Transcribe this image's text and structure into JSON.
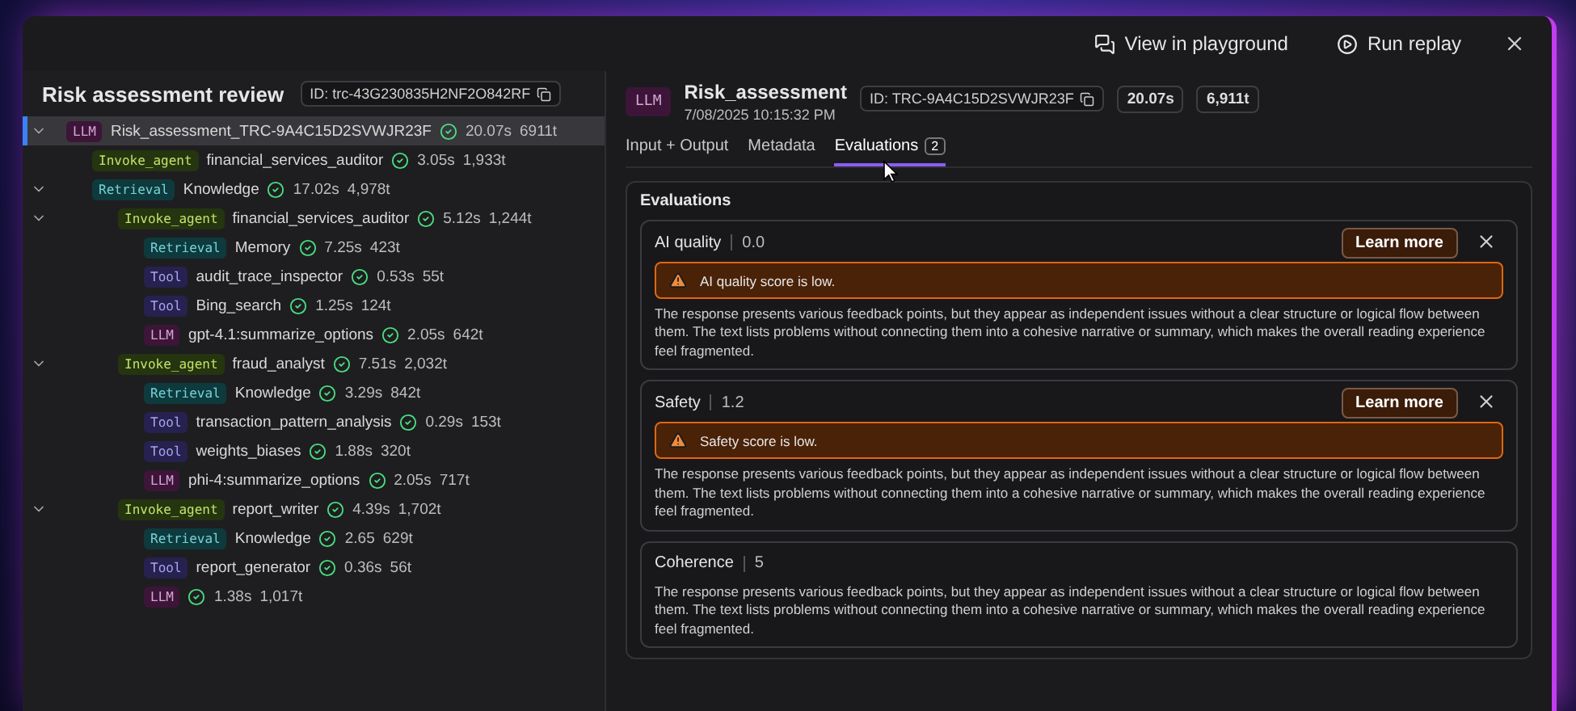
{
  "toolbar": {
    "actions": [
      {
        "kind": "playground",
        "label": "View in playground"
      },
      {
        "kind": "replay",
        "label": "Run replay"
      }
    ]
  },
  "trace": {
    "title": "Risk assessment review",
    "id": "ID: trc-43G230835H2NF2O842RF",
    "tree": [
      {
        "kind": "llm",
        "tag": "LLM",
        "name": "Risk_assessment_TRC-9A4C15D2SVWJR23F",
        "succeeded": true,
        "duration": "20.07s",
        "tokens": "6911t",
        "selected": true,
        "expanded": true,
        "children": [
          {
            "kind": "invoke_agent",
            "tag": "Invoke_agent",
            "name": "financial_services_auditor",
            "succeeded": true,
            "duration": "3.05s",
            "tokens": "1,933t",
            "selected": false
          },
          {
            "kind": "retrieval",
            "tag": "Retrieval",
            "name": "Knowledge",
            "succeeded": true,
            "duration": "17.02s",
            "tokens": "4,978t",
            "selected": false,
            "expanded": true,
            "children": [
              {
                "kind": "invoke_agent",
                "tag": "Invoke_agent",
                "name": "financial_services_auditor",
                "succeeded": true,
                "duration": "5.12s",
                "tokens": "1,244t",
                "selected": false,
                "expanded": true,
                "children": [
                  {
                    "kind": "retrieval",
                    "tag": "Retrieval",
                    "name": "Memory",
                    "succeeded": true,
                    "duration": "7.25s",
                    "tokens": "423t",
                    "selected": false
                  },
                  {
                    "kind": "tool",
                    "tag": "Tool",
                    "name": "audit_trace_inspector",
                    "succeeded": true,
                    "duration": "0.53s",
                    "tokens": "55t",
                    "selected": false
                  },
                  {
                    "kind": "tool",
                    "tag": "Tool",
                    "name": "Bing_search",
                    "succeeded": true,
                    "duration": "1.25s",
                    "tokens": "124t",
                    "selected": false
                  },
                  {
                    "kind": "llm",
                    "tag": "LLM",
                    "name": "gpt-4.1:summarize_options",
                    "succeeded": true,
                    "duration": "2.05s",
                    "tokens": "642t",
                    "selected": false
                  }
                ]
              },
              {
                "kind": "invoke_agent",
                "tag": "Invoke_agent",
                "name": "fraud_analyst",
                "succeeded": true,
                "duration": "7.51s",
                "tokens": "2,032t",
                "selected": false,
                "expanded": true,
                "children": [
                  {
                    "kind": "retrieval",
                    "tag": "Retrieval",
                    "name": "Knowledge",
                    "succeeded": true,
                    "duration": "3.29s",
                    "tokens": "842t",
                    "selected": false
                  },
                  {
                    "kind": "tool",
                    "tag": "Tool",
                    "name": "transaction_pattern_analysis",
                    "succeeded": true,
                    "duration": "0.29s",
                    "tokens": "153t",
                    "selected": false
                  },
                  {
                    "kind": "tool",
                    "tag": "Tool",
                    "name": "weights_biases",
                    "succeeded": true,
                    "duration": "1.88s",
                    "tokens": "320t",
                    "selected": false
                  },
                  {
                    "kind": "llm",
                    "tag": "LLM",
                    "name": "phi-4:summarize_options",
                    "succeeded": true,
                    "duration": "2.05s",
                    "tokens": "717t",
                    "selected": false
                  }
                ]
              },
              {
                "kind": "invoke_agent",
                "tag": "Invoke_agent",
                "name": "report_writer",
                "succeeded": true,
                "duration": "4.39s",
                "tokens": "1,702t",
                "selected": false,
                "expanded": true,
                "children": [
                  {
                    "kind": "retrieval",
                    "tag": "Retrieval",
                    "name": "Knowledge",
                    "succeeded": true,
                    "duration": "2.65",
                    "tokens": "629t",
                    "selected": false
                  },
                  {
                    "kind": "tool",
                    "tag": "Tool",
                    "name": "report_generator",
                    "succeeded": true,
                    "duration": "0.36s",
                    "tokens": "56t",
                    "selected": false
                  },
                  {
                    "kind": "llm",
                    "tag": "LLM",
                    "succeeded": true,
                    "duration": "1.38s",
                    "tokens": "1,017t",
                    "selected": false
                  }
                ]
              }
            ]
          }
        ]
      }
    ]
  },
  "detail": {
    "kind": "llm",
    "tag": "LLM",
    "name": "Risk_assessment",
    "timestamp": "7/08/2025 10:15:32 PM",
    "id": "ID: TRC-9A4C15D2SVWJR23F",
    "chips": [
      "20.07s",
      "6,911t"
    ],
    "tabs": [
      {
        "label": "Input + Output",
        "selected": false
      },
      {
        "label": "Metadata",
        "selected": false
      },
      {
        "label": "Evaluations",
        "badge": "2",
        "selected": true
      }
    ],
    "evaluations": {
      "title": "Evaluations",
      "items": [
        {
          "name": "AI quality",
          "score": "0.0",
          "alert": {
            "kind": "warning",
            "message": "AI quality score is low.",
            "action": "Learn more"
          },
          "description": "The response presents various feedback points, but they appear as independent issues without a clear structure or logical flow between them. The text lists problems without connecting them into a cohesive narrative or summary, which makes the overall reading experience feel fragmented."
        },
        {
          "name": "Safety",
          "score": "1.2",
          "alert": {
            "kind": "warning",
            "message": "Safety score is low.",
            "action": "Learn more"
          },
          "description": "The response presents various feedback points, but they appear as independent issues without a clear structure or logical flow between them. The text lists problems without connecting them into a cohesive narrative or summary, which makes the overall reading experience feel fragmented."
        },
        {
          "name": "Coherence",
          "score": "5",
          "description": "The response presents various feedback points, but they appear as independent issues without a clear structure or logical flow between them. The text lists problems without connecting them into a cohesive narrative or summary, which makes the overall reading experience feel fragmented."
        }
      ]
    }
  }
}
